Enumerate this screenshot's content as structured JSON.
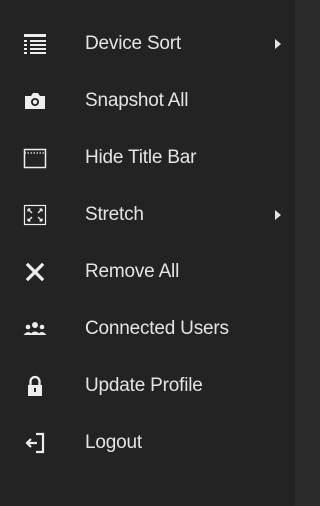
{
  "menu": {
    "items": [
      {
        "label": "Device Sort",
        "icon": "list-icon",
        "has_submenu": true
      },
      {
        "label": "Snapshot All",
        "icon": "camera-icon",
        "has_submenu": false
      },
      {
        "label": "Hide Title Bar",
        "icon": "window-titlebar-icon",
        "has_submenu": false
      },
      {
        "label": "Stretch",
        "icon": "stretch-icon",
        "has_submenu": true
      },
      {
        "label": "Remove All",
        "icon": "close-icon",
        "has_submenu": false
      },
      {
        "label": "Connected Users",
        "icon": "users-icon",
        "has_submenu": false
      },
      {
        "label": "Update Profile",
        "icon": "lock-icon",
        "has_submenu": false
      },
      {
        "label": "Logout",
        "icon": "logout-icon",
        "has_submenu": false
      }
    ]
  },
  "colors": {
    "background": "#232323",
    "text": "#e4e4e4",
    "icon": "#ededed"
  }
}
